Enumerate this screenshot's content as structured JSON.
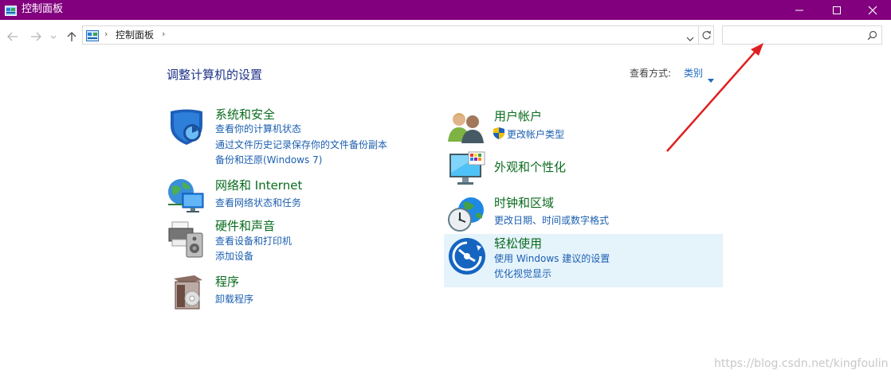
{
  "window": {
    "title": "控制面板"
  },
  "address_bar": {
    "breadcrumb": "控制面板",
    "separator": "›",
    "search_placeholder": ""
  },
  "content": {
    "heading": "调整计算机的设置",
    "view_by_label": "查看方式:",
    "view_by_value": "类别",
    "categories": [
      {
        "title": "系统和安全",
        "icon": "shield-icon",
        "links": [
          "查看你的计算机状态",
          "通过文件历史记录保存你的文件备份副本",
          "备份和还原(Windows 7)"
        ]
      },
      {
        "title": "网络和 Internet",
        "icon": "network-globe-icon",
        "links": [
          "查看网络状态和任务"
        ]
      },
      {
        "title": "硬件和声音",
        "icon": "printer-speaker-icon",
        "links": [
          "查看设备和打印机",
          "添加设备"
        ]
      },
      {
        "title": "程序",
        "icon": "programs-box-icon",
        "links": [
          "卸载程序"
        ]
      },
      {
        "title": "用户帐户",
        "icon": "users-icon",
        "links": [
          "更改帐户类型"
        ]
      },
      {
        "title": "外观和个性化",
        "icon": "monitor-palette-icon",
        "links": []
      },
      {
        "title": "时钟和区域",
        "icon": "clock-globe-icon",
        "links": [
          "更改日期、时间或数字格式"
        ]
      },
      {
        "title": "轻松使用",
        "icon": "ease-of-access-icon",
        "links": [
          "使用 Windows 建议的设置",
          "优化视觉显示"
        ]
      }
    ]
  },
  "annotation": {
    "color": "#e02020"
  },
  "watermark": "https://blog.csdn.net/kingfoulin",
  "colors": {
    "titlebar": "#82007e",
    "heading": "#1e3287",
    "category_title": "#0a6b1e",
    "link": "#1b5fb0",
    "hover_highlight": "#e5f3fb"
  }
}
